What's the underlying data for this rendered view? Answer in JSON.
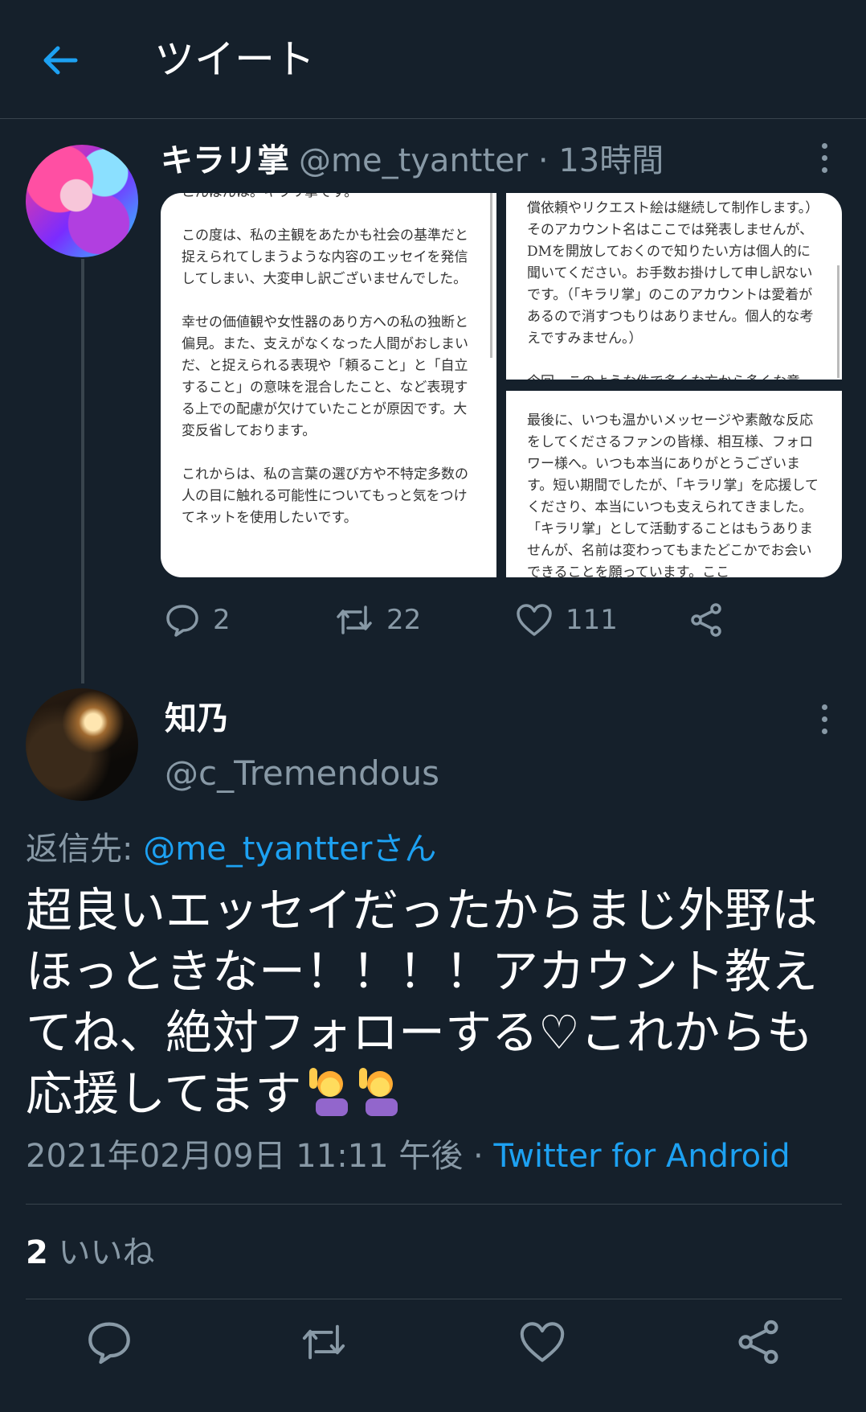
{
  "header": {
    "title": "ツイート"
  },
  "parent_tweet": {
    "author_name": "キラリ掌",
    "author_handle": "@me_tyantter · 13時間",
    "images": {
      "left_text": "こんばんは。キラリ掌です。\n\nこの度は、私の主観をあたかも社会の基準だと捉えられてしまうような内容のエッセイを発信してしまい、大変申し訳ございませんでした。\n\n幸せの価値観や女性器のあり方への私の独断と偏見。また、支えがなくなった人間がおしまいだ、と捉えられる表現や「頼ること」と「自立すること」の意味を混合したこと、など表現する上での配慮が欠けていたことが原因です。大変反省しております。\n\nこれからは、私の言葉の選び方や不特定多数の人の目に触れる可能性についてもっと気をつけてネットを使用したいです。",
      "top_right_text": "償依頼やリクエスト絵は継続して制作します。）そのアカウント名はここでは発表しませんが、DMを開放しておくので知りたい方は個人的に聞いてください。お手数お掛けして申し訳ないです。（「キラリ掌」のこのアカウントは愛着があるので消すつもりはありません。個人的な考えですみません。）\n\n今回、このような件で多くな方から多くな意",
      "bottom_right_text": "最後に、いつも温かいメッセージや素敵な反応をしてくださるファンの皆様、相互様、フォロワー様へ。いつも本当にありがとうございます。短い期間でしたが、「キラリ掌」を応援してくださり、本当にいつも支えられてきました。「キラリ掌」として活動することはもうありませんが、名前は変わってもまたどこかでお会いできることを願っています。ここ"
    },
    "replies": "2",
    "retweets": "22",
    "likes": "111"
  },
  "reply_tweet": {
    "author_name": "知乃",
    "author_handle": "@c_Tremendous",
    "reply_to_label": "返信先: ",
    "reply_to_handle": "@me_tyantterさん",
    "text": "超良いエッセイだったからまじ外野はほっときなー！！！！アカウント教えてね、絶対フォローする♡これからも応援してます",
    "timestamp": "2021年02月09日 11:11 午後 · ",
    "source": "Twitter for Android",
    "like_count": "2",
    "like_label": " いいね"
  },
  "colors": {
    "background": "#15202b",
    "divider": "#38444d",
    "secondary_text": "#8899a6",
    "accent": "#1da1f2"
  },
  "icons": [
    "back-arrow-icon",
    "more-icon",
    "reply-icon",
    "retweet-icon",
    "like-icon",
    "share-icon",
    "person-raising-hand-emoji"
  ]
}
